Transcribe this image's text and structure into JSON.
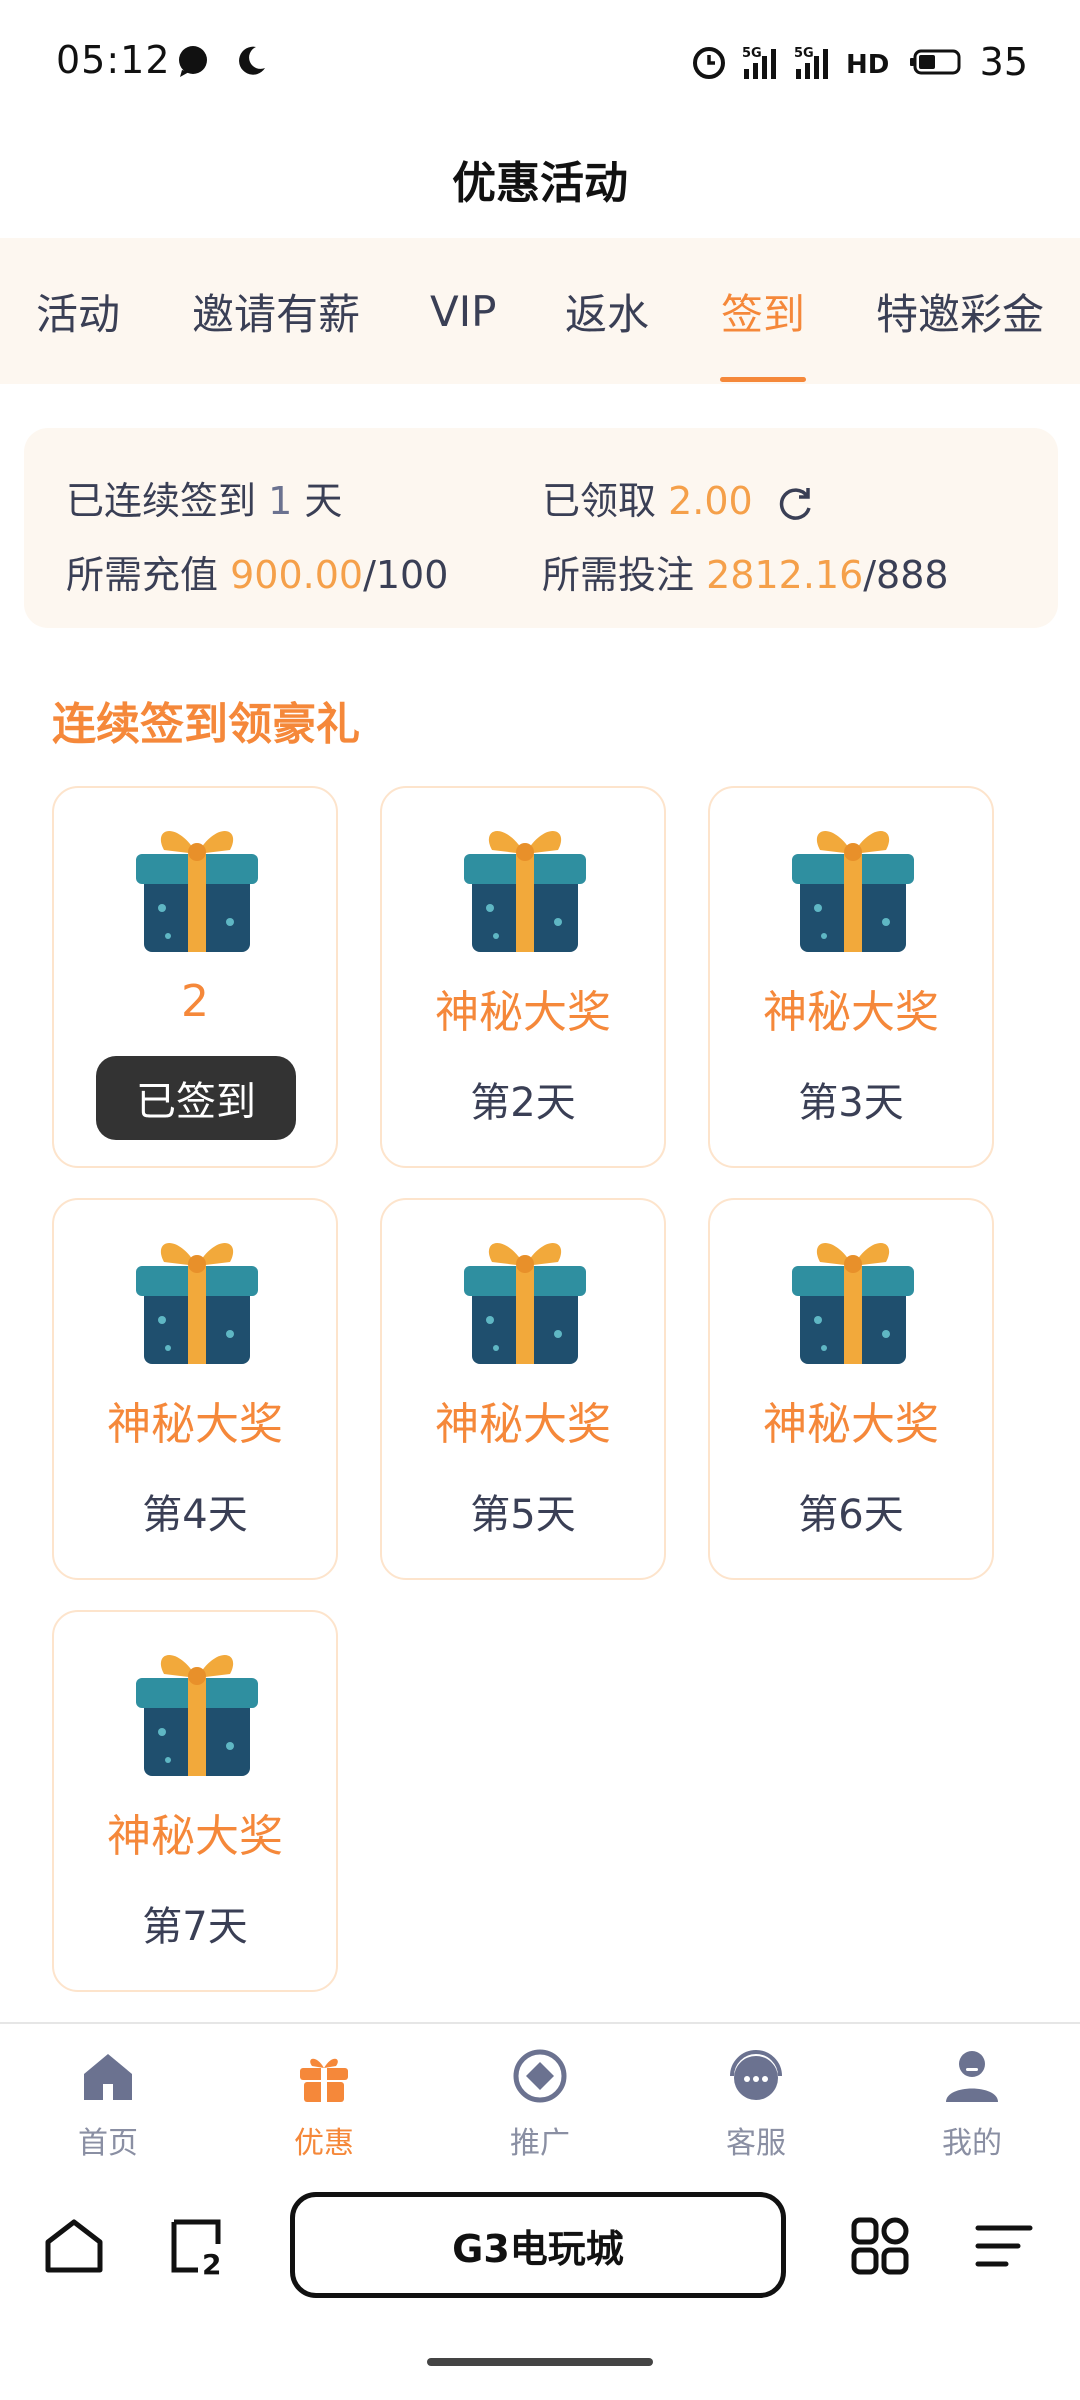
{
  "status_bar": {
    "time": "05:12",
    "battery": "35",
    "icons": [
      "chat-bubble-icon",
      "moon-icon",
      "alarm-icon",
      "signal-5g-icon",
      "signal-5g-icon",
      "hd-icon",
      "battery-icon"
    ]
  },
  "header": {
    "title": "优惠活动"
  },
  "tabs": [
    {
      "label": "活动"
    },
    {
      "label": "邀请有薪"
    },
    {
      "label": "VIP"
    },
    {
      "label": "返水"
    },
    {
      "label": "签到"
    },
    {
      "label": "特邀彩金"
    }
  ],
  "active_tab": 4,
  "summary": {
    "streak_prefix": "已连续签到",
    "streak_days": "1",
    "streak_suffix": "天",
    "claimed_label": "已领取",
    "claimed_value": "2.00",
    "deposit_label": "所需充值",
    "deposit_current": "900.00",
    "deposit_target": "/100",
    "bet_label": "所需投注",
    "bet_current": "2812.16",
    "bet_target": "/888"
  },
  "section_title": "连续签到领豪礼",
  "rewards": [
    {
      "prize": "2",
      "action": "已签到"
    },
    {
      "prize": "神秘大奖",
      "day": "第2天"
    },
    {
      "prize": "神秘大奖",
      "day": "第3天"
    },
    {
      "prize": "神秘大奖",
      "day": "第4天"
    },
    {
      "prize": "神秘大奖",
      "day": "第5天"
    },
    {
      "prize": "神秘大奖",
      "day": "第6天"
    },
    {
      "prize": "神秘大奖",
      "day": "第7天"
    }
  ],
  "bottom_nav": [
    {
      "label": "首页",
      "icon": "home-icon"
    },
    {
      "label": "优惠",
      "icon": "gift-icon"
    },
    {
      "label": "推广",
      "icon": "promote-icon"
    },
    {
      "label": "客服",
      "icon": "support-icon"
    },
    {
      "label": "我的",
      "icon": "user-icon"
    }
  ],
  "active_nav": 1,
  "browser": {
    "url_title": "G3电玩城",
    "tab_count": "2"
  },
  "colors": {
    "accent": "#f5883a",
    "accent_light": "#f5a04a",
    "tab_bg": "#fdf7f0",
    "text": "#3a3f55",
    "card_border": "#fde4cc"
  }
}
